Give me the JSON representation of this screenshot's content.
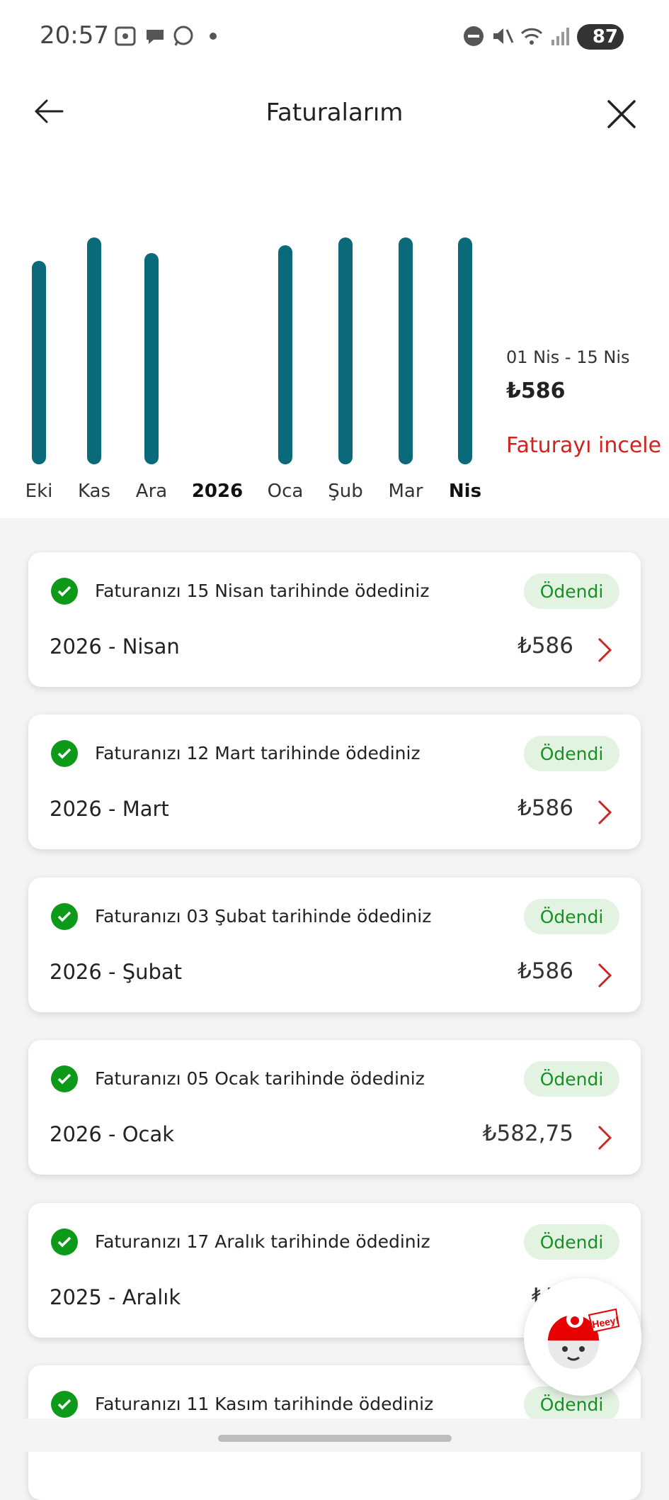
{
  "status_bar": {
    "time": "20:57",
    "battery": "87"
  },
  "header": {
    "title": "Faturalarım"
  },
  "chart_data": {
    "type": "bar",
    "categories": [
      "Eki",
      "Kas",
      "Ara",
      "2026",
      "Oca",
      "Şub",
      "Mar",
      "Nis"
    ],
    "values": [
      577,
      586,
      580,
      null,
      583,
      586,
      586,
      586
    ],
    "highlighted": "Nis",
    "ylim": [
      0,
      586
    ],
    "title": "",
    "xlabel": "",
    "ylabel": "",
    "grid": false,
    "bar_color": "#0b6a7a"
  },
  "summary": {
    "period": "01 Nis - 15 Nis",
    "amount": "₺586",
    "link": "Faturayı incele"
  },
  "bills": [
    {
      "message": "Faturanızı 15 Nisan tarihinde ödediniz",
      "status": "Ödendi",
      "period": "2026 - Nisan",
      "amount": "₺586"
    },
    {
      "message": "Faturanızı 12 Mart tarihinde ödediniz",
      "status": "Ödendi",
      "period": "2026 - Mart",
      "amount": "₺586"
    },
    {
      "message": "Faturanızı 03 Şubat tarihinde ödediniz",
      "status": "Ödendi",
      "period": "2026 - Şubat",
      "amount": "₺586"
    },
    {
      "message": "Faturanızı 05 Ocak tarihinde ödediniz",
      "status": "Ödendi",
      "period": "2026 - Ocak",
      "amount": "₺582,75"
    },
    {
      "message": "Faturanızı 17 Aralık tarihinde ödediniz",
      "status": "Ödendi",
      "period": "2025 - Aralık",
      "amount": "₺58"
    },
    {
      "message": "Faturanızı 11 Kasım tarihinde ödediniz",
      "status": "Ödendi",
      "period": "",
      "amount": ""
    }
  ],
  "assistant": {
    "bubble_text": "Heey!"
  },
  "colors": {
    "accent_red": "#d0231e",
    "bar_teal": "#0b6a7a",
    "paid_green": "#0c9a18",
    "paid_badge_bg": "#e3f3e2"
  }
}
